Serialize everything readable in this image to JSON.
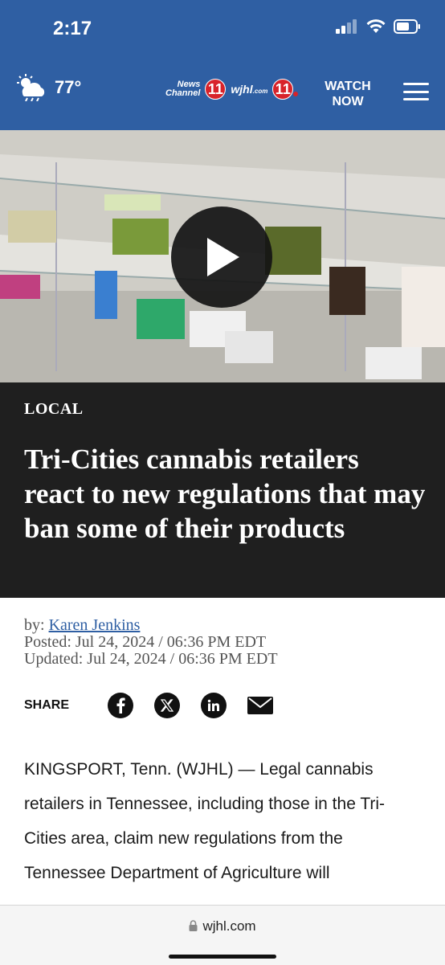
{
  "status": {
    "time": "2:17"
  },
  "header": {
    "temperature": "77°",
    "logo_news": "News",
    "logo_channel": "Channel",
    "logo_number": "11",
    "logo_wjhl": "wjhl",
    "logo_com": ".com",
    "watch_line1": "WATCH",
    "watch_line2": "NOW"
  },
  "article": {
    "section": "LOCAL",
    "headline": "Tri-Cities cannabis retailers react to new regulations that may ban some of their products",
    "by_label": "by:",
    "author": "Karen Jenkins",
    "posted": "Posted: Jul 24, 2024 / 06:36 PM EDT",
    "updated": "Updated: Jul 24, 2024 / 06:36 PM EDT",
    "share_label": "SHARE",
    "body": "KINGSPORT, Tenn. (WJHL) — Legal cannabis retailers in Tennessee, including those in the Tri-Cities area, claim new regulations from the Tennessee Department of Agriculture will"
  },
  "browser": {
    "url": "wjhl.com"
  },
  "colors": {
    "header_blue": "#2f5fa3",
    "title_bg": "#1f1f1f",
    "brand_red": "#d8232a"
  }
}
